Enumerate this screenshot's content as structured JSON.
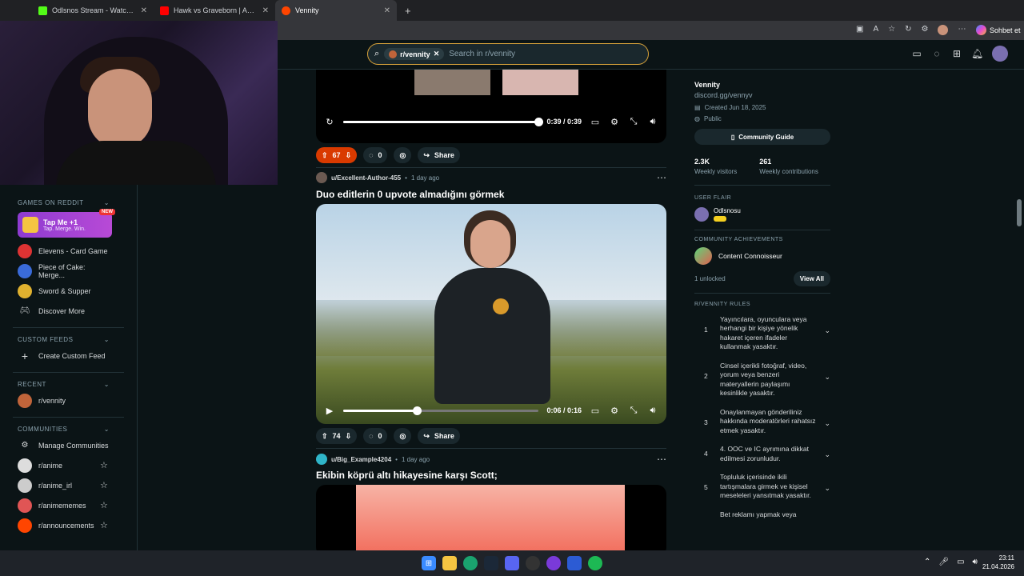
{
  "browser": {
    "tabs": [
      {
        "label": "Odlsnos Stream - Watch Live on K",
        "favicon_color": "#53fc18",
        "active": false
      },
      {
        "label": "Hawk vs Graveborn | Adam Kaçırm",
        "favicon_color": "#ff0000",
        "active": false
      },
      {
        "label": "Vennity",
        "favicon_color": "#ff4500",
        "active": true
      }
    ],
    "new_tab": "+",
    "chat_button": "Sohbet et"
  },
  "header": {
    "search_chip": "r/vennity",
    "search_placeholder": "Search in r/vennity"
  },
  "left_nav": {
    "games_heading": "GAMES ON REDDIT",
    "tap_me": {
      "title": "Tap Me +1",
      "subtitle": "Tap. Merge. Win.",
      "badge": "NEW"
    },
    "games": [
      {
        "label": "Elevens - Card Game",
        "icon": "cards-icon"
      },
      {
        "label": "Piece of Cake: Merge...",
        "icon": "cake-icon"
      },
      {
        "label": "Sword & Supper",
        "icon": "sword-icon"
      },
      {
        "label": "Discover More",
        "icon": "gamepad-icon"
      }
    ],
    "custom_feeds_heading": "CUSTOM FEEDS",
    "create_custom_feed": "Create Custom Feed",
    "recent_heading": "RECENT",
    "recent": [
      {
        "label": "r/vennity"
      }
    ],
    "communities_heading": "COMMUNITIES",
    "manage_communities": "Manage Communities",
    "communities": [
      {
        "label": "r/anime"
      },
      {
        "label": "r/anime_irl"
      },
      {
        "label": "r/animememes"
      },
      {
        "label": "r/announcements"
      }
    ]
  },
  "posts": [
    {
      "video": {
        "time": "0:39 / 0:39",
        "progress": 1.0
      },
      "votes": "67",
      "upvoted": true,
      "comments": "0",
      "share": "Share"
    },
    {
      "author": "u/Excellent-Author-455",
      "age": "1 day ago",
      "title": "Duo editlerin 0 upvote almadığını görmek",
      "video": {
        "time": "0:06 / 0:16",
        "progress": 0.375
      },
      "votes": "74",
      "upvoted": false,
      "comments": "0",
      "share": "Share"
    },
    {
      "author": "u/Big_Example4204",
      "age": "1 day ago",
      "title": "Ekibin köprü altı hikayesine karşı Scott;"
    }
  ],
  "sidebar": {
    "name": "Vennity",
    "link": "discord.gg/vennyv",
    "created": "Created Jun 18, 2025",
    "visibility": "Public",
    "guide_button": "Community Guide",
    "stats": [
      {
        "value": "2.3K",
        "label": "Weekly visitors"
      },
      {
        "value": "261",
        "label": "Weekly contributions"
      }
    ],
    "user_flair_heading": "USER FLAIR",
    "flair_user": "Odlsnosu",
    "achievements_heading": "COMMUNITY ACHIEVEMENTS",
    "achievement": "Content Connoisseur",
    "unlocked": "1 unlocked",
    "view_all": "View All",
    "rules_heading": "R/VENNITY RULES",
    "rules": [
      {
        "n": "1",
        "text": "Yayıncılara, oyunculara veya herhangi bir kişiye yönelik hakaret içeren ifadeler kullanmak yasaktır."
      },
      {
        "n": "2",
        "text": "Cinsel içerikli fotoğraf, video, yorum veya benzeri materyallerin paylaşımı kesinlikle yasaktır."
      },
      {
        "n": "3",
        "text": "Onaylanmayan gönderiliniz hakkında moderatörleri rahatsız etmek yasaktır."
      },
      {
        "n": "4",
        "text": "4. OOC ve IC ayrımına dikkat edilmesi zorunludur."
      },
      {
        "n": "5",
        "text": "Topluluk içerisinde ikili tartışmalara girmek ve kişisel meseleleri yansıtmak yasaktır."
      },
      {
        "n": "",
        "text": "Bet reklamı yapmak veya"
      }
    ]
  },
  "taskbar": {
    "time": "23:11",
    "date": "21.04.2026"
  }
}
